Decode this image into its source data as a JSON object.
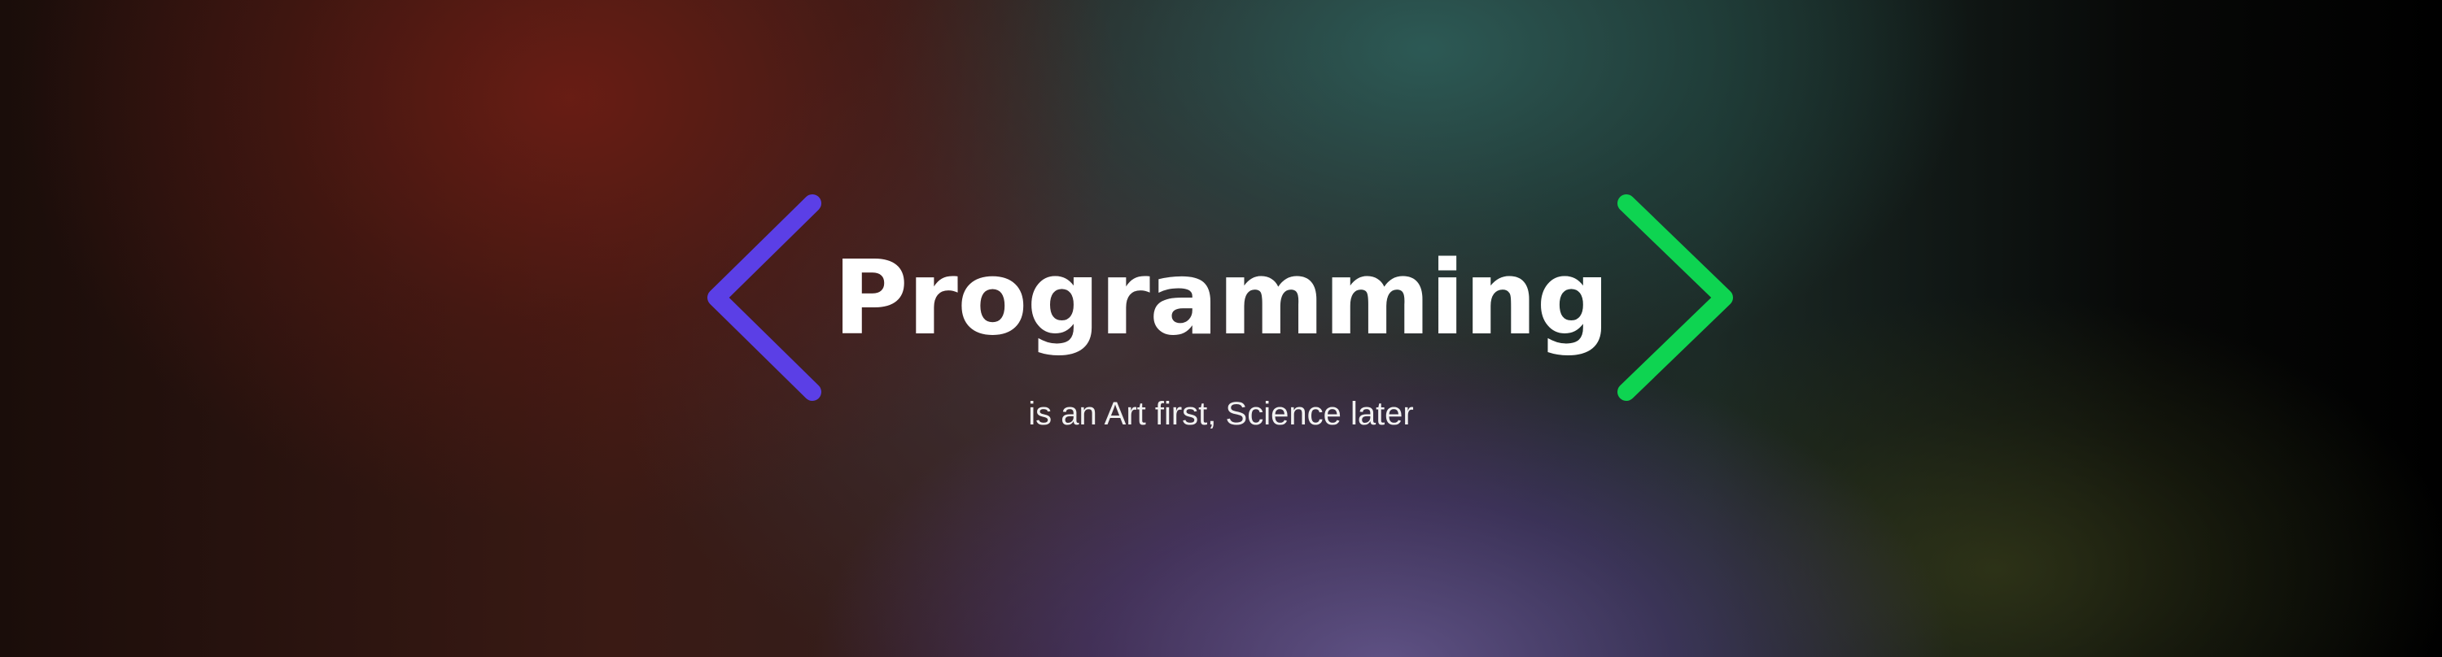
{
  "banner": {
    "title": "Programming",
    "subtitle": "is an Art first, Science later"
  },
  "icons": {
    "left": "chevron-left-icon",
    "right": "chevron-right-icon"
  },
  "colors": {
    "left_chevron": "#5b3fe6",
    "right_chevron": "#0ed451",
    "text": "#ffffff"
  }
}
